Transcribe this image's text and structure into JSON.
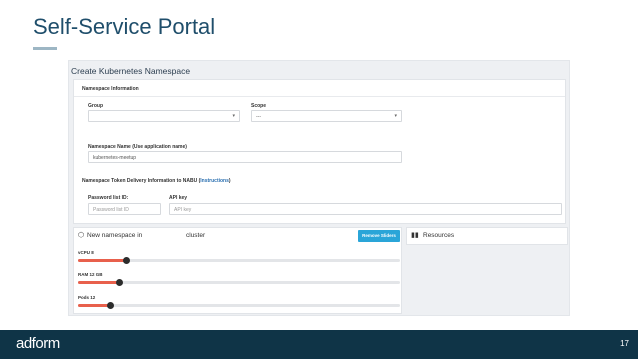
{
  "slide": {
    "title": "Self-Service Portal",
    "page_number": "17",
    "logo_text": "adform"
  },
  "portal": {
    "page_heading": "Create Kubernetes Namespace",
    "namespace_info": {
      "section_title": "Namespace Information",
      "group_label": "Group",
      "group_value": "",
      "scope_label": "Scope",
      "scope_value": "---",
      "name_label": "Namespace Name (Use application name)",
      "name_value": "kubernetes-meetup",
      "token_label": "Namespace Token Delivery Information to NABU",
      "token_link_open": "(",
      "token_link": "Instructions",
      "token_link_close": ")",
      "password_id_label": "Password list ID:",
      "password_id_placeholder": "Password list ID",
      "api_key_label": "API key",
      "api_key_placeholder": "API key"
    },
    "new_namespace": {
      "title_prefix": "New namespace in",
      "title_suffix": "cluster",
      "remove_button": "Remove Sliders",
      "sliders": [
        {
          "label": "vCPU 8",
          "level": 0.15
        },
        {
          "label": "RAM 12 GB",
          "level": 0.13
        },
        {
          "label": "Pods 12",
          "level": 0.1
        }
      ]
    },
    "resources": {
      "title": "Resources"
    }
  },
  "colors": {
    "slide_title": "#1f4e6b",
    "footer_bg": "#0f3447",
    "slider_fill": "#e8604c",
    "button_bg": "#2aa5d8",
    "link": "#2a6fb0"
  }
}
